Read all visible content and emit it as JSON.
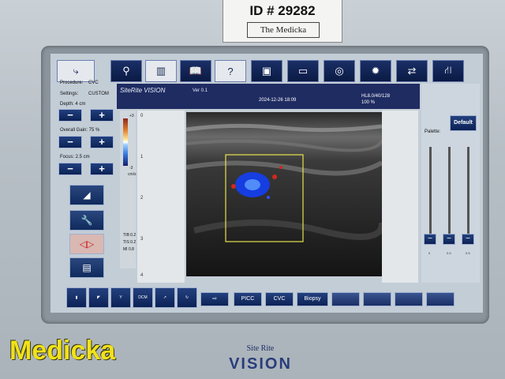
{
  "sticker": {
    "id_text": "ID # 29282",
    "brand_text": "The Medicka"
  },
  "toolbar": {
    "icons": [
      "exit-icon",
      "zoom-icon",
      "ruler-icon",
      "book-icon",
      "help-icon",
      "save-icon",
      "folder-icon",
      "reel-icon",
      "brightness-icon",
      "swap-icon",
      "road-icon"
    ]
  },
  "leftpanel": {
    "procedure_label": "Procedure:",
    "procedure_value": "CVC",
    "settings_label": "Settings:",
    "settings_value": "CUSTOM",
    "depth": "Depth: 4 cm",
    "gain": "Overall Gain: 75 %",
    "focus": "Focus: 2.5 cm",
    "minus": "−",
    "plus": "+"
  },
  "view": {
    "brand": "SiteRite VISION",
    "version": "Ver 0.1",
    "datetime": "2024-12-26  18:09",
    "probe": "HL8.0/40/128",
    "percent": "100 %",
    "scale_top": "+3",
    "scale_bottom": "-3",
    "scale_unit": "cm/s",
    "tib": "TIB 0.2",
    "tis": "TIS 0.2",
    "mi": "MI 0.8",
    "depth_ticks": [
      "0",
      "1",
      "2",
      "3",
      "4"
    ]
  },
  "rightpanel": {
    "palette_label": "Palette:",
    "default_label": "Default",
    "slider_ticks": [
      "0",
      "0.5",
      "0.5"
    ]
  },
  "bottombar": {
    "dcm_label": "DCM",
    "picc": "PICC",
    "cvc": "CVC",
    "biopsy": "Biopsy"
  },
  "watermark": "Medicka",
  "logo": {
    "line1": "Site Rite",
    "line2": "VISION"
  },
  "colors": {
    "panel_blue": "#0c2256",
    "doppler_blue": "#2d4bff",
    "doppler_red": "#d0281c",
    "roi_box": "#e8e24a"
  }
}
